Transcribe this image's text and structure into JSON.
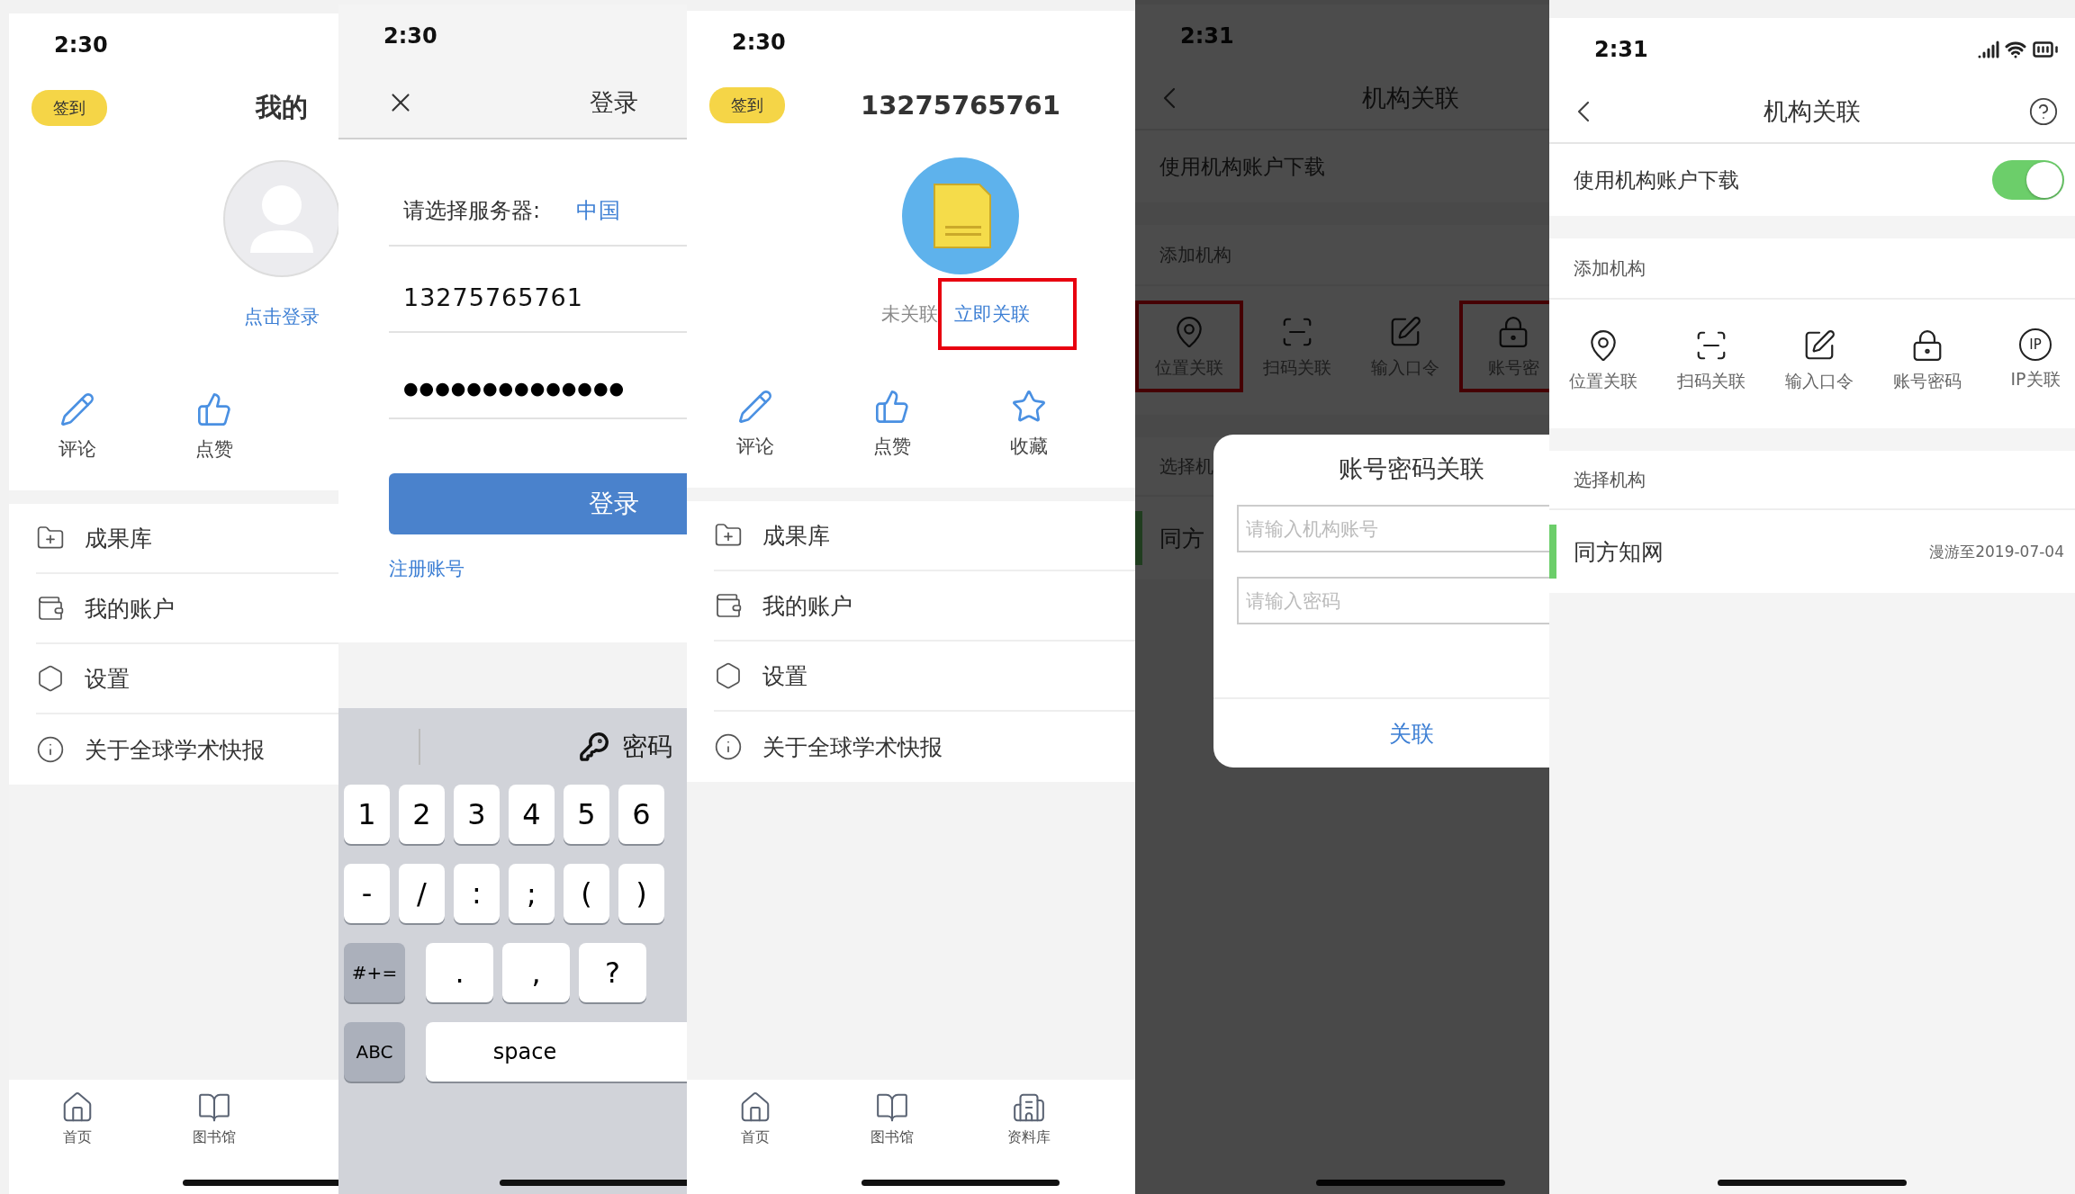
{
  "screens": [
    {
      "kind": "profile",
      "time": "2:30",
      "checkin": "签到",
      "title": "我的",
      "account": {
        "link": "点击登录",
        "highlighted": false
      },
      "actions": [
        {
          "label": "评论"
        },
        {
          "label": "点赞"
        }
      ],
      "menu": [
        {
          "label": "成果库"
        },
        {
          "label": "我的账户"
        },
        {
          "label": "设置"
        },
        {
          "label": "关于全球学术快报"
        }
      ],
      "tabs": [
        {
          "label": "首页"
        },
        {
          "label": "图书馆"
        }
      ]
    },
    {
      "kind": "login",
      "time": "2:30",
      "title": "登录",
      "server_label": "请选择服务器:",
      "server_value": "中国",
      "phone": "13275765761",
      "password": "●●●●●●●●●●●●●●",
      "submit": "登录",
      "register": "注册账号",
      "keyboard": {
        "suggestion": "密码",
        "number_keys": [
          {
            "label": "1",
            "kind": "char"
          },
          {
            "label": "2",
            "kind": "char"
          },
          {
            "label": "3",
            "kind": "char"
          },
          {
            "label": "4",
            "kind": "char"
          },
          {
            "label": "5",
            "kind": "char"
          },
          {
            "label": "6",
            "kind": "char"
          }
        ],
        "symbol_keys": [
          {
            "label": "-",
            "kind": "char"
          },
          {
            "label": "/",
            "kind": "char"
          },
          {
            "label": ":",
            "kind": "char"
          },
          {
            "label": ";",
            "kind": "char"
          },
          {
            "label": "(",
            "kind": "char"
          },
          {
            "label": ")",
            "kind": "char"
          }
        ],
        "punctuation_keys": [
          {
            "label": "#+=",
            "kind": "modifier"
          },
          {
            "label": ".",
            "kind": "wide"
          },
          {
            "label": ",",
            "kind": "wide"
          },
          {
            "label": "?",
            "kind": "wide"
          }
        ],
        "bottom_keys": [
          {
            "label": "ABC",
            "kind": "modifier"
          },
          {
            "label": "space",
            "kind": "space"
          }
        ]
      }
    },
    {
      "kind": "profile",
      "time": "2:30",
      "checkin": "签到",
      "title": "13275765761",
      "account": {
        "status": "未关联",
        "link": "立即关联",
        "highlighted": true
      },
      "actions": [
        {
          "label": "评论"
        },
        {
          "label": "点赞"
        },
        {
          "label": "收藏"
        }
      ],
      "menu": [
        {
          "label": "成果库"
        },
        {
          "label": "我的账户"
        },
        {
          "label": "设置"
        },
        {
          "label": "关于全球学术快报"
        }
      ],
      "tabs": [
        {
          "label": "首页"
        },
        {
          "label": "图书馆"
        },
        {
          "label": "资料库"
        }
      ]
    },
    {
      "kind": "institution",
      "time": "2:31",
      "title": "机构关联",
      "dimmed": true,
      "download": {
        "label": "使用机构账户下载"
      },
      "add_title": "添加机构",
      "methods": [
        {
          "label": "位置关联",
          "highlighted": true
        },
        {
          "label": "扫码关联",
          "highlighted": false
        },
        {
          "label": "输入口令",
          "highlighted": false
        },
        {
          "label": "账号密",
          "highlighted": true
        }
      ],
      "select_title": "选择机",
      "orgs": [
        {
          "name": "同方",
          "selected": true
        }
      ],
      "dialog": {
        "title": "账号密码关联",
        "fields": [
          {
            "placeholder": "请输入机构账号"
          },
          {
            "placeholder": "请输入密码"
          }
        ],
        "confirm": "关联"
      }
    },
    {
      "kind": "institution",
      "time": "2:31",
      "title": "机构关联",
      "download": {
        "label": "使用机构账户下载",
        "on": true
      },
      "add_title": "添加机构",
      "methods": [
        {
          "label": "位置关联",
          "highlighted": false
        },
        {
          "label": "扫码关联",
          "highlighted": false
        },
        {
          "label": "输入口令",
          "highlighted": false
        },
        {
          "label": "账号密码",
          "highlighted": false
        },
        {
          "label": "IP关联",
          "badge": "IP",
          "highlighted": false
        }
      ],
      "select_title": "选择机构",
      "orgs": [
        {
          "name": "同方知网",
          "expiry": "漫游至2019-07-04",
          "selected": true
        }
      ]
    }
  ]
}
